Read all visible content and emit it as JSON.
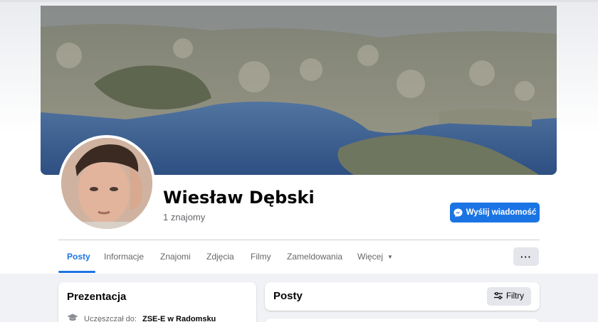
{
  "profile": {
    "name": "Wiesław Dębski",
    "friends": "1 znajomy",
    "message_button": "Wyślij wiadomość"
  },
  "tabs": [
    {
      "label": "Posty",
      "active": true
    },
    {
      "label": "Informacje"
    },
    {
      "label": "Znajomi"
    },
    {
      "label": "Zdjęcia"
    },
    {
      "label": "Filmy"
    },
    {
      "label": "Zameldowania"
    },
    {
      "label": "Więcej"
    }
  ],
  "more_button": "···",
  "intro": {
    "title": "Prezentacja",
    "education_prefix": "Uczęszczał do:",
    "education_school": "ZSE-E w Radomsku"
  },
  "posts": {
    "title": "Posty",
    "filters_label": "Filtry"
  },
  "icons": {
    "messenger": "messenger-icon",
    "graduation": "graduation-cap-icon",
    "filters": "sliders-icon",
    "caret": "caret-down-icon"
  },
  "colors": {
    "accent": "#1b74e4",
    "secondary_button": "#e4e6eb",
    "page_background": "#f0f2f5"
  }
}
